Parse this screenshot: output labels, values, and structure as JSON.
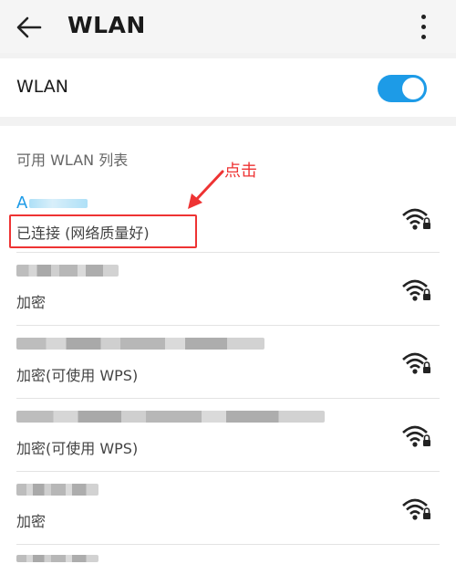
{
  "header": {
    "title": "WLAN"
  },
  "wlan_toggle": {
    "label": "WLAN",
    "on": true
  },
  "list": {
    "title": "可用 WLAN 列表",
    "networks": [
      {
        "name": "A",
        "status": "已连接 (网络质量好)",
        "connected": true
      },
      {
        "status": "加密"
      },
      {
        "status": "加密(可使用 WPS)"
      },
      {
        "status": "加密(可使用 WPS)"
      },
      {
        "status": "加密"
      }
    ]
  },
  "annotation": {
    "text": "点击"
  },
  "colors": {
    "accent": "#1d9be7",
    "annotation": "#ee3333"
  }
}
